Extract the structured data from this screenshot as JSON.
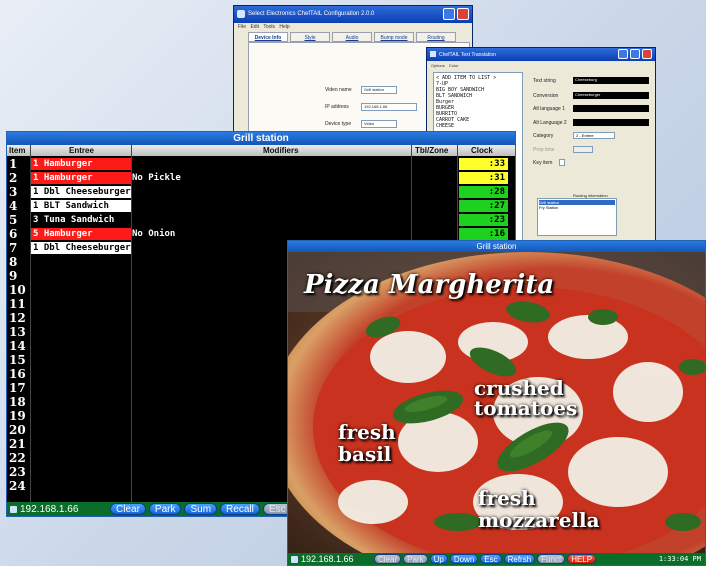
{
  "config_window": {
    "title": "Select Electronics ChefTAIL Configuration 2.0.0",
    "menu": "File  Edit  Tools  Help",
    "tabs": [
      "Device Info",
      "Style",
      "Audio",
      "Bump mode",
      "Routing",
      "Misc."
    ],
    "video_name_label": "Video name",
    "video_name_value": "Grill station",
    "ip_label": "IP address",
    "ip_value": "192.168.1.66",
    "ping_label": "Ping",
    "device_type_label": "Device type",
    "device_type_value": "Video"
  },
  "translation_window": {
    "title": "ChefTAIL Text Translation",
    "menu": "Options  Color",
    "list_items": [
      "< ADD ITEM TO LIST >",
      "7-UP",
      "BIG BOY SANDWICH",
      "BLT SANDWICH",
      "Burger",
      "BURGER",
      "BURRITO",
      "CARROT CAKE",
      "CHEESE"
    ],
    "text_string_label": "Text string",
    "text_string_value": "Cheeseburg",
    "conversion_label": "Conversion",
    "conversion_value": "Cheeseburger",
    "alt_lang1_label": "Alt language 1",
    "alt_lang2_label": "Alt Language 2",
    "category_label": "Category",
    "category_value": "2 - Entree",
    "prep_time_label": "Prep time",
    "key_item_label": "Key item",
    "routing_label": "Routing information",
    "routing_items": [
      "Grill station",
      "Fry Station"
    ]
  },
  "kds": {
    "title": "Grill station",
    "headers": {
      "item": "Item",
      "entree": "Entree",
      "modifiers": "Modifiers",
      "tbl_zone": "Tbl/Zone",
      "clock": "Clock"
    },
    "row_numbers": [
      "1",
      "2",
      "3",
      "4",
      "5",
      "6",
      "7",
      "8",
      "9",
      "10",
      "11",
      "12",
      "13",
      "14",
      "15",
      "16",
      "17",
      "18",
      "19",
      "20",
      "21",
      "22",
      "23",
      "24"
    ],
    "orders": [
      {
        "entree": "1 Hamburger",
        "modifier": "",
        "clock": ":33",
        "entree_color": "red",
        "clock_color": "yellow"
      },
      {
        "entree": "1 Hamburger",
        "modifier": "No Pickle",
        "clock": ":31",
        "entree_color": "red",
        "clock_color": "yellow"
      },
      {
        "entree": "1 Dbl Cheeseburger",
        "modifier": "",
        "clock": ":28",
        "entree_color": "white",
        "clock_color": "green"
      },
      {
        "entree": "1 BLT Sandwich",
        "modifier": "",
        "clock": ":27",
        "entree_color": "white",
        "clock_color": "green"
      },
      {
        "entree": "3 Tuna Sandwich",
        "modifier": "",
        "clock": ":23",
        "entree_color": "none",
        "clock_color": "green"
      },
      {
        "entree": "5 Hamburger",
        "modifier": "No Onion",
        "clock": ":16",
        "entree_color": "red",
        "clock_color": "green"
      },
      {
        "entree": "1 Dbl Cheeseburger",
        "modifier": "",
        "clock": ":16",
        "entree_color": "white",
        "clock_color": "green"
      }
    ],
    "status_ip": "192.168.1.66",
    "buttons": [
      "Clear",
      "Park",
      "Sum",
      "Recall",
      "Esc"
    ]
  },
  "pizza_display": {
    "title": "Grill station",
    "headline": "Pizza Margherita",
    "label_tomatoes_1": "crushed",
    "label_tomatoes_2": "tomatoes",
    "label_basil_1": "fresh",
    "label_basil_2": "basil",
    "label_mozz_1": "fresh",
    "label_mozz_2": "mozzarella",
    "status_ip": "192.168.1.66",
    "buttons": [
      "Clear",
      "Park",
      "Up",
      "Down",
      "Esc",
      "Refrsh",
      "Funct",
      "HELP"
    ],
    "time": "1:33:04 PM"
  },
  "colors": {
    "kds_red": "#ff1a1a",
    "kds_yellow": "#ffff2b",
    "kds_green": "#1ed11e",
    "status_green": "#0b6d2a",
    "title_blue": "#1e6bd0"
  }
}
